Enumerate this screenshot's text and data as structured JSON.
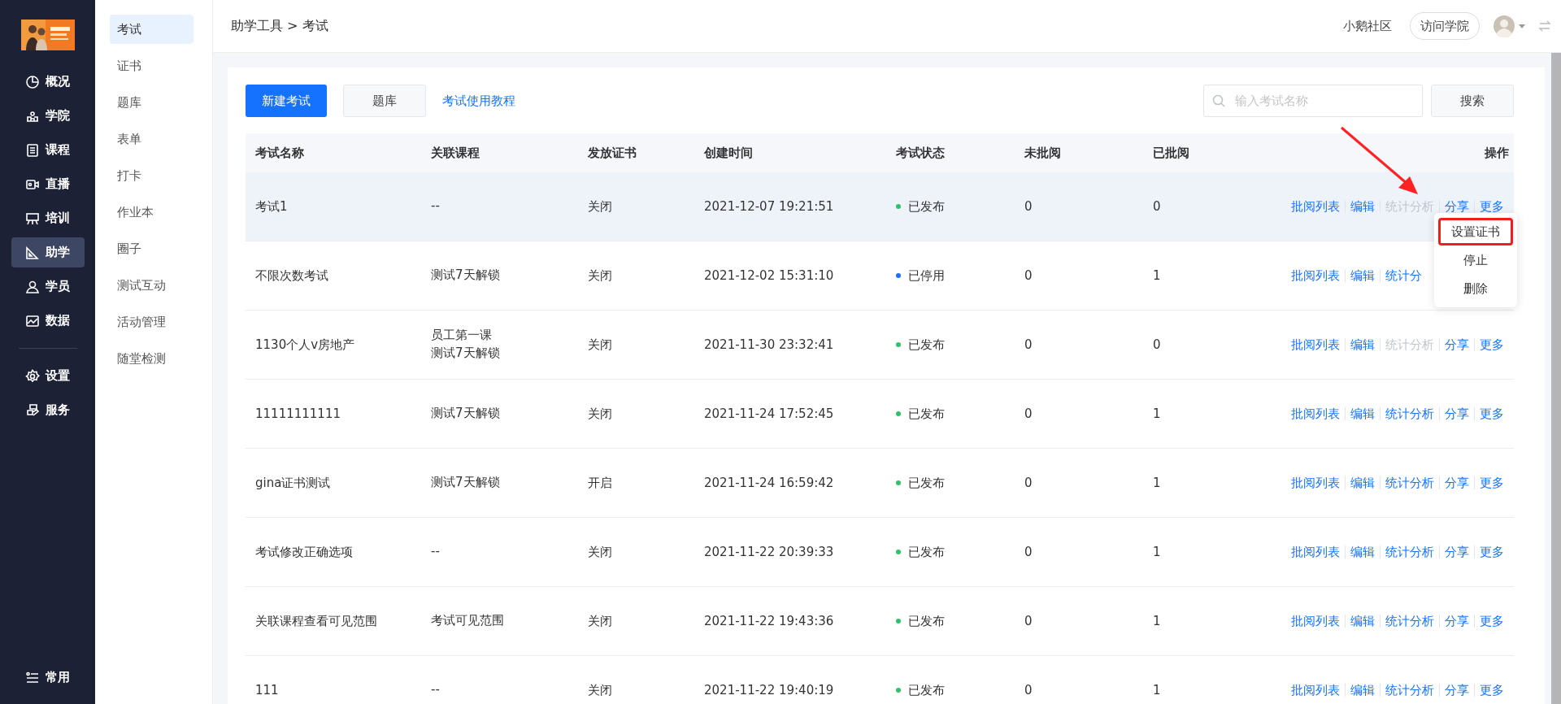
{
  "sidebar": {
    "items": [
      {
        "label": "概况",
        "selected": false
      },
      {
        "label": "学院",
        "selected": false
      },
      {
        "label": "课程",
        "selected": false
      },
      {
        "label": "直播",
        "selected": false
      },
      {
        "label": "培训",
        "selected": false
      },
      {
        "label": "助学",
        "selected": true
      },
      {
        "label": "学员",
        "selected": false
      },
      {
        "label": "数据",
        "selected": false
      }
    ],
    "system_items": [
      {
        "label": "设置",
        "selected": false
      },
      {
        "label": "服务",
        "selected": false
      }
    ],
    "footer": "常用"
  },
  "subnav": {
    "items": [
      {
        "label": "考试",
        "selected": true
      },
      {
        "label": "证书",
        "selected": false
      },
      {
        "label": "题库",
        "selected": false
      },
      {
        "label": "表单",
        "selected": false
      },
      {
        "label": "打卡",
        "selected": false
      },
      {
        "label": "作业本",
        "selected": false
      },
      {
        "label": "圈子",
        "selected": false
      },
      {
        "label": "测试互动",
        "selected": false
      },
      {
        "label": "活动管理",
        "selected": false
      },
      {
        "label": "随堂检测",
        "selected": false
      }
    ]
  },
  "header": {
    "breadcrumb": "助学工具 > 考试",
    "community": "小鹅社区",
    "visit_button": "访问学院"
  },
  "toolbar": {
    "new_button": "新建考试",
    "bank_button": "题库",
    "tutorial_link": "考试使用教程",
    "search": {
      "placeholder": "输入考试名称"
    },
    "search_button": "搜索"
  },
  "table": {
    "columns": [
      "考试名称",
      "关联课程",
      "发放证书",
      "创建时间",
      "考试状态",
      "未批阅",
      "已批阅",
      "操作"
    ],
    "rows": [
      {
        "name": "考试1",
        "courses": [
          "--"
        ],
        "certificate": "关闭",
        "created": "2021-12-07 19:21:51",
        "status": "已发布",
        "color": "#2fc26c",
        "unreviewed": "0",
        "reviewed": "0",
        "hovered": true,
        "actions": [
          {
            "label": "批阅列表",
            "disabled": false
          },
          {
            "label": "编辑",
            "disabled": false
          },
          {
            "label": "统计分析",
            "disabled": true
          },
          {
            "label": "分享",
            "disabled": false
          },
          {
            "label": "更多",
            "disabled": false
          }
        ]
      },
      {
        "name": "不限次数考试",
        "courses": [
          "测试7天解锁"
        ],
        "certificate": "关闭",
        "created": "2021-12-02 15:31:10",
        "status": "已停用",
        "color": "#1e6fff",
        "unreviewed": "0",
        "reviewed": "1",
        "hovered": false,
        "actions": [
          {
            "label": "批阅列表",
            "disabled": false
          },
          {
            "label": "编辑",
            "disabled": false
          },
          {
            "label": "统计分",
            "disabled": false
          }
        ]
      },
      {
        "name": "1130个人v房地产",
        "courses": [
          "员工第一课",
          "测试7天解锁"
        ],
        "certificate": "关闭",
        "created": "2021-11-30 23:32:41",
        "status": "已发布",
        "color": "#2fc26c",
        "unreviewed": "0",
        "reviewed": "0",
        "hovered": false,
        "actions": [
          {
            "label": "批阅列表",
            "disabled": false
          },
          {
            "label": "编辑",
            "disabled": false
          },
          {
            "label": "统计分析",
            "disabled": true
          },
          {
            "label": "分享",
            "disabled": false
          },
          {
            "label": "更多",
            "disabled": false
          }
        ]
      },
      {
        "name": "11111111111",
        "courses": [
          "测试7天解锁"
        ],
        "certificate": "关闭",
        "created": "2021-11-24 17:52:45",
        "status": "已发布",
        "color": "#2fc26c",
        "unreviewed": "0",
        "reviewed": "1",
        "hovered": false,
        "actions": [
          {
            "label": "批阅列表",
            "disabled": false
          },
          {
            "label": "编辑",
            "disabled": false
          },
          {
            "label": "统计分析",
            "disabled": false
          },
          {
            "label": "分享",
            "disabled": false
          },
          {
            "label": "更多",
            "disabled": false
          }
        ]
      },
      {
        "name": "gina证书测试",
        "courses": [
          "测试7天解锁"
        ],
        "certificate": "开启",
        "created": "2021-11-24 16:59:42",
        "status": "已发布",
        "color": "#2fc26c",
        "unreviewed": "0",
        "reviewed": "1",
        "hovered": false,
        "actions": [
          {
            "label": "批阅列表",
            "disabled": false
          },
          {
            "label": "编辑",
            "disabled": false
          },
          {
            "label": "统计分析",
            "disabled": false
          },
          {
            "label": "分享",
            "disabled": false
          },
          {
            "label": "更多",
            "disabled": false
          }
        ]
      },
      {
        "name": "考试修改正确选项",
        "courses": [
          "--"
        ],
        "certificate": "关闭",
        "created": "2021-11-22 20:39:33",
        "status": "已发布",
        "color": "#2fc26c",
        "unreviewed": "0",
        "reviewed": "1",
        "hovered": false,
        "actions": [
          {
            "label": "批阅列表",
            "disabled": false
          },
          {
            "label": "编辑",
            "disabled": false
          },
          {
            "label": "统计分析",
            "disabled": false
          },
          {
            "label": "分享",
            "disabled": false
          },
          {
            "label": "更多",
            "disabled": false
          }
        ]
      },
      {
        "name": "关联课程查看可见范围",
        "courses": [
          "考试可见范围"
        ],
        "certificate": "关闭",
        "created": "2021-11-22 19:43:36",
        "status": "已发布",
        "color": "#2fc26c",
        "unreviewed": "0",
        "reviewed": "1",
        "hovered": false,
        "actions": [
          {
            "label": "批阅列表",
            "disabled": false
          },
          {
            "label": "编辑",
            "disabled": false
          },
          {
            "label": "统计分析",
            "disabled": false
          },
          {
            "label": "分享",
            "disabled": false
          },
          {
            "label": "更多",
            "disabled": false
          }
        ]
      },
      {
        "name": "111",
        "courses": [
          "--"
        ],
        "certificate": "关闭",
        "created": "2021-11-22 19:40:19",
        "status": "已发布",
        "color": "#2fc26c",
        "unreviewed": "0",
        "reviewed": "1",
        "hovered": false,
        "actions": [
          {
            "label": "批阅列表",
            "disabled": false
          },
          {
            "label": "编辑",
            "disabled": false
          },
          {
            "label": "统计分析",
            "disabled": false
          },
          {
            "label": "分享",
            "disabled": false
          },
          {
            "label": "更多",
            "disabled": false
          }
        ]
      }
    ]
  },
  "more_menu": {
    "items": [
      {
        "label": "设置证书",
        "highlighted": true
      },
      {
        "label": "停止",
        "highlighted": false
      },
      {
        "label": "删除",
        "highlighted": false
      }
    ]
  }
}
